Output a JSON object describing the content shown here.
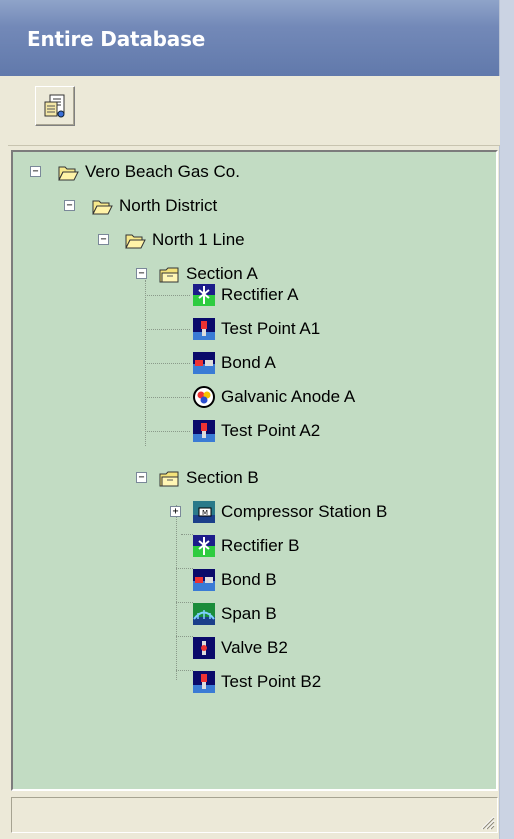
{
  "window": {
    "title": "Entire Database"
  },
  "toolbar": {
    "report_button_icon": "report-icon"
  },
  "tree": {
    "root": "Vero Beach Gas Co.",
    "district": "North District",
    "line": "North 1 Line",
    "section_a": {
      "label": "Section A",
      "items": [
        "Rectifier A",
        "Test Point A1",
        "Bond A",
        "Galvanic Anode A",
        "Test Point A2"
      ]
    },
    "section_b": {
      "label": "Section B",
      "items": [
        "Compressor Station B",
        "Rectifier B",
        "Bond B",
        "Span B",
        "Valve B2",
        "Test Point B2"
      ]
    },
    "expanders": {
      "expanded": "−",
      "collapsed": "+"
    }
  },
  "colors": {
    "tree_background": "#c2dcc3",
    "titlebar": "#7389b8"
  }
}
